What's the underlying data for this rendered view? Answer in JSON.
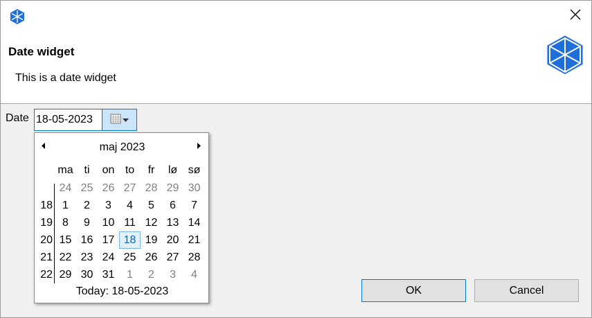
{
  "window": {
    "app_icon": "cube-logo-icon",
    "close_icon": "close-icon"
  },
  "header": {
    "title": "Date widget",
    "message": "This is a date widget",
    "banner_icon": "cube-logo-icon"
  },
  "field": {
    "label": "Date",
    "value": "18-05-2023",
    "button_icon": "calendar-icon"
  },
  "calendar": {
    "month_label": "maj 2023",
    "prev_icon": "arrow-left-icon",
    "next_icon": "arrow-right-icon",
    "weekdays": [
      "ma",
      "ti",
      "on",
      "to",
      "fr",
      "lø",
      "sø"
    ],
    "weeks": [
      {
        "week": "",
        "days": [
          {
            "d": "24",
            "other": true
          },
          {
            "d": "25",
            "other": true
          },
          {
            "d": "26",
            "other": true
          },
          {
            "d": "27",
            "other": true
          },
          {
            "d": "28",
            "other": true
          },
          {
            "d": "29",
            "other": true
          },
          {
            "d": "30",
            "other": true
          }
        ]
      },
      {
        "week": "18",
        "days": [
          {
            "d": "1"
          },
          {
            "d": "2"
          },
          {
            "d": "3"
          },
          {
            "d": "4"
          },
          {
            "d": "5"
          },
          {
            "d": "6"
          },
          {
            "d": "7"
          }
        ]
      },
      {
        "week": "19",
        "days": [
          {
            "d": "8"
          },
          {
            "d": "9"
          },
          {
            "d": "10"
          },
          {
            "d": "11"
          },
          {
            "d": "12"
          },
          {
            "d": "13"
          },
          {
            "d": "14"
          }
        ]
      },
      {
        "week": "20",
        "days": [
          {
            "d": "15"
          },
          {
            "d": "16"
          },
          {
            "d": "17"
          },
          {
            "d": "18",
            "selected": true
          },
          {
            "d": "19"
          },
          {
            "d": "20"
          },
          {
            "d": "21"
          }
        ]
      },
      {
        "week": "21",
        "days": [
          {
            "d": "22"
          },
          {
            "d": "23"
          },
          {
            "d": "24"
          },
          {
            "d": "25"
          },
          {
            "d": "26"
          },
          {
            "d": "27"
          },
          {
            "d": "28"
          }
        ]
      },
      {
        "week": "22",
        "days": [
          {
            "d": "29"
          },
          {
            "d": "30"
          },
          {
            "d": "31"
          },
          {
            "d": "1",
            "other": true
          },
          {
            "d": "2",
            "other": true
          },
          {
            "d": "3",
            "other": true
          },
          {
            "d": "4",
            "other": true
          }
        ]
      }
    ],
    "today_label": "Today: 18-05-2023"
  },
  "buttons": {
    "ok": "OK",
    "cancel": "Cancel"
  },
  "colors": {
    "accent": "#0078d7",
    "logo": "#1e6fd9",
    "selected_text": "#0066cc",
    "other_month": "#808080"
  }
}
